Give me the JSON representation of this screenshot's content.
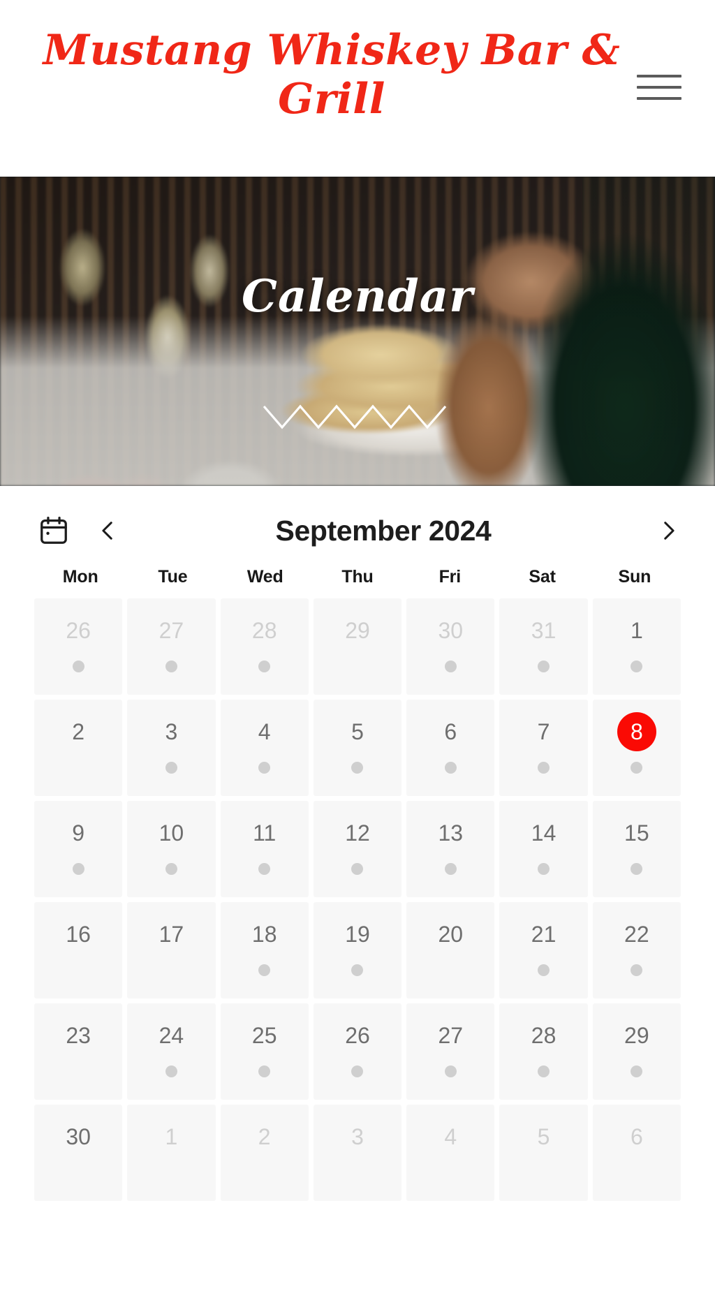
{
  "header": {
    "brand_title": "Mustang Whiskey Bar & Grill",
    "brand_color": "#f02717",
    "menu_icon": "hamburger-menu-icon"
  },
  "hero": {
    "title": "Calendar",
    "divider_icon": "zigzag-divider"
  },
  "calendar": {
    "icon": "calendar-icon",
    "prev_label": "‹",
    "next_label": "›",
    "month_title": "September 2024",
    "selected_day": 8,
    "selected_color": "#fa0a04",
    "weekdays": [
      "Mon",
      "Tue",
      "Wed",
      "Thu",
      "Fri",
      "Sat",
      "Sun"
    ],
    "weeks": [
      [
        {
          "day": "26",
          "other_month": true,
          "has_event": true,
          "selected": false
        },
        {
          "day": "27",
          "other_month": true,
          "has_event": true,
          "selected": false
        },
        {
          "day": "28",
          "other_month": true,
          "has_event": true,
          "selected": false
        },
        {
          "day": "29",
          "other_month": true,
          "has_event": false,
          "selected": false
        },
        {
          "day": "30",
          "other_month": true,
          "has_event": true,
          "selected": false
        },
        {
          "day": "31",
          "other_month": true,
          "has_event": true,
          "selected": false
        },
        {
          "day": "1",
          "other_month": false,
          "has_event": true,
          "selected": false
        }
      ],
      [
        {
          "day": "2",
          "other_month": false,
          "has_event": false,
          "selected": false
        },
        {
          "day": "3",
          "other_month": false,
          "has_event": true,
          "selected": false
        },
        {
          "day": "4",
          "other_month": false,
          "has_event": true,
          "selected": false
        },
        {
          "day": "5",
          "other_month": false,
          "has_event": true,
          "selected": false
        },
        {
          "day": "6",
          "other_month": false,
          "has_event": true,
          "selected": false
        },
        {
          "day": "7",
          "other_month": false,
          "has_event": true,
          "selected": false
        },
        {
          "day": "8",
          "other_month": false,
          "has_event": true,
          "selected": true
        }
      ],
      [
        {
          "day": "9",
          "other_month": false,
          "has_event": true,
          "selected": false
        },
        {
          "day": "10",
          "other_month": false,
          "has_event": true,
          "selected": false
        },
        {
          "day": "11",
          "other_month": false,
          "has_event": true,
          "selected": false
        },
        {
          "day": "12",
          "other_month": false,
          "has_event": true,
          "selected": false
        },
        {
          "day": "13",
          "other_month": false,
          "has_event": true,
          "selected": false
        },
        {
          "day": "14",
          "other_month": false,
          "has_event": true,
          "selected": false
        },
        {
          "day": "15",
          "other_month": false,
          "has_event": true,
          "selected": false
        }
      ],
      [
        {
          "day": "16",
          "other_month": false,
          "has_event": false,
          "selected": false
        },
        {
          "day": "17",
          "other_month": false,
          "has_event": false,
          "selected": false
        },
        {
          "day": "18",
          "other_month": false,
          "has_event": true,
          "selected": false
        },
        {
          "day": "19",
          "other_month": false,
          "has_event": true,
          "selected": false
        },
        {
          "day": "20",
          "other_month": false,
          "has_event": false,
          "selected": false
        },
        {
          "day": "21",
          "other_month": false,
          "has_event": true,
          "selected": false
        },
        {
          "day": "22",
          "other_month": false,
          "has_event": true,
          "selected": false
        }
      ],
      [
        {
          "day": "23",
          "other_month": false,
          "has_event": false,
          "selected": false
        },
        {
          "day": "24",
          "other_month": false,
          "has_event": true,
          "selected": false
        },
        {
          "day": "25",
          "other_month": false,
          "has_event": true,
          "selected": false
        },
        {
          "day": "26",
          "other_month": false,
          "has_event": true,
          "selected": false
        },
        {
          "day": "27",
          "other_month": false,
          "has_event": true,
          "selected": false
        },
        {
          "day": "28",
          "other_month": false,
          "has_event": true,
          "selected": false
        },
        {
          "day": "29",
          "other_month": false,
          "has_event": true,
          "selected": false
        }
      ],
      [
        {
          "day": "30",
          "other_month": false,
          "has_event": false,
          "selected": false
        },
        {
          "day": "1",
          "other_month": true,
          "has_event": false,
          "selected": false
        },
        {
          "day": "2",
          "other_month": true,
          "has_event": false,
          "selected": false
        },
        {
          "day": "3",
          "other_month": true,
          "has_event": false,
          "selected": false
        },
        {
          "day": "4",
          "other_month": true,
          "has_event": false,
          "selected": false
        },
        {
          "day": "5",
          "other_month": true,
          "has_event": false,
          "selected": false
        },
        {
          "day": "6",
          "other_month": true,
          "has_event": false,
          "selected": false
        }
      ]
    ]
  }
}
